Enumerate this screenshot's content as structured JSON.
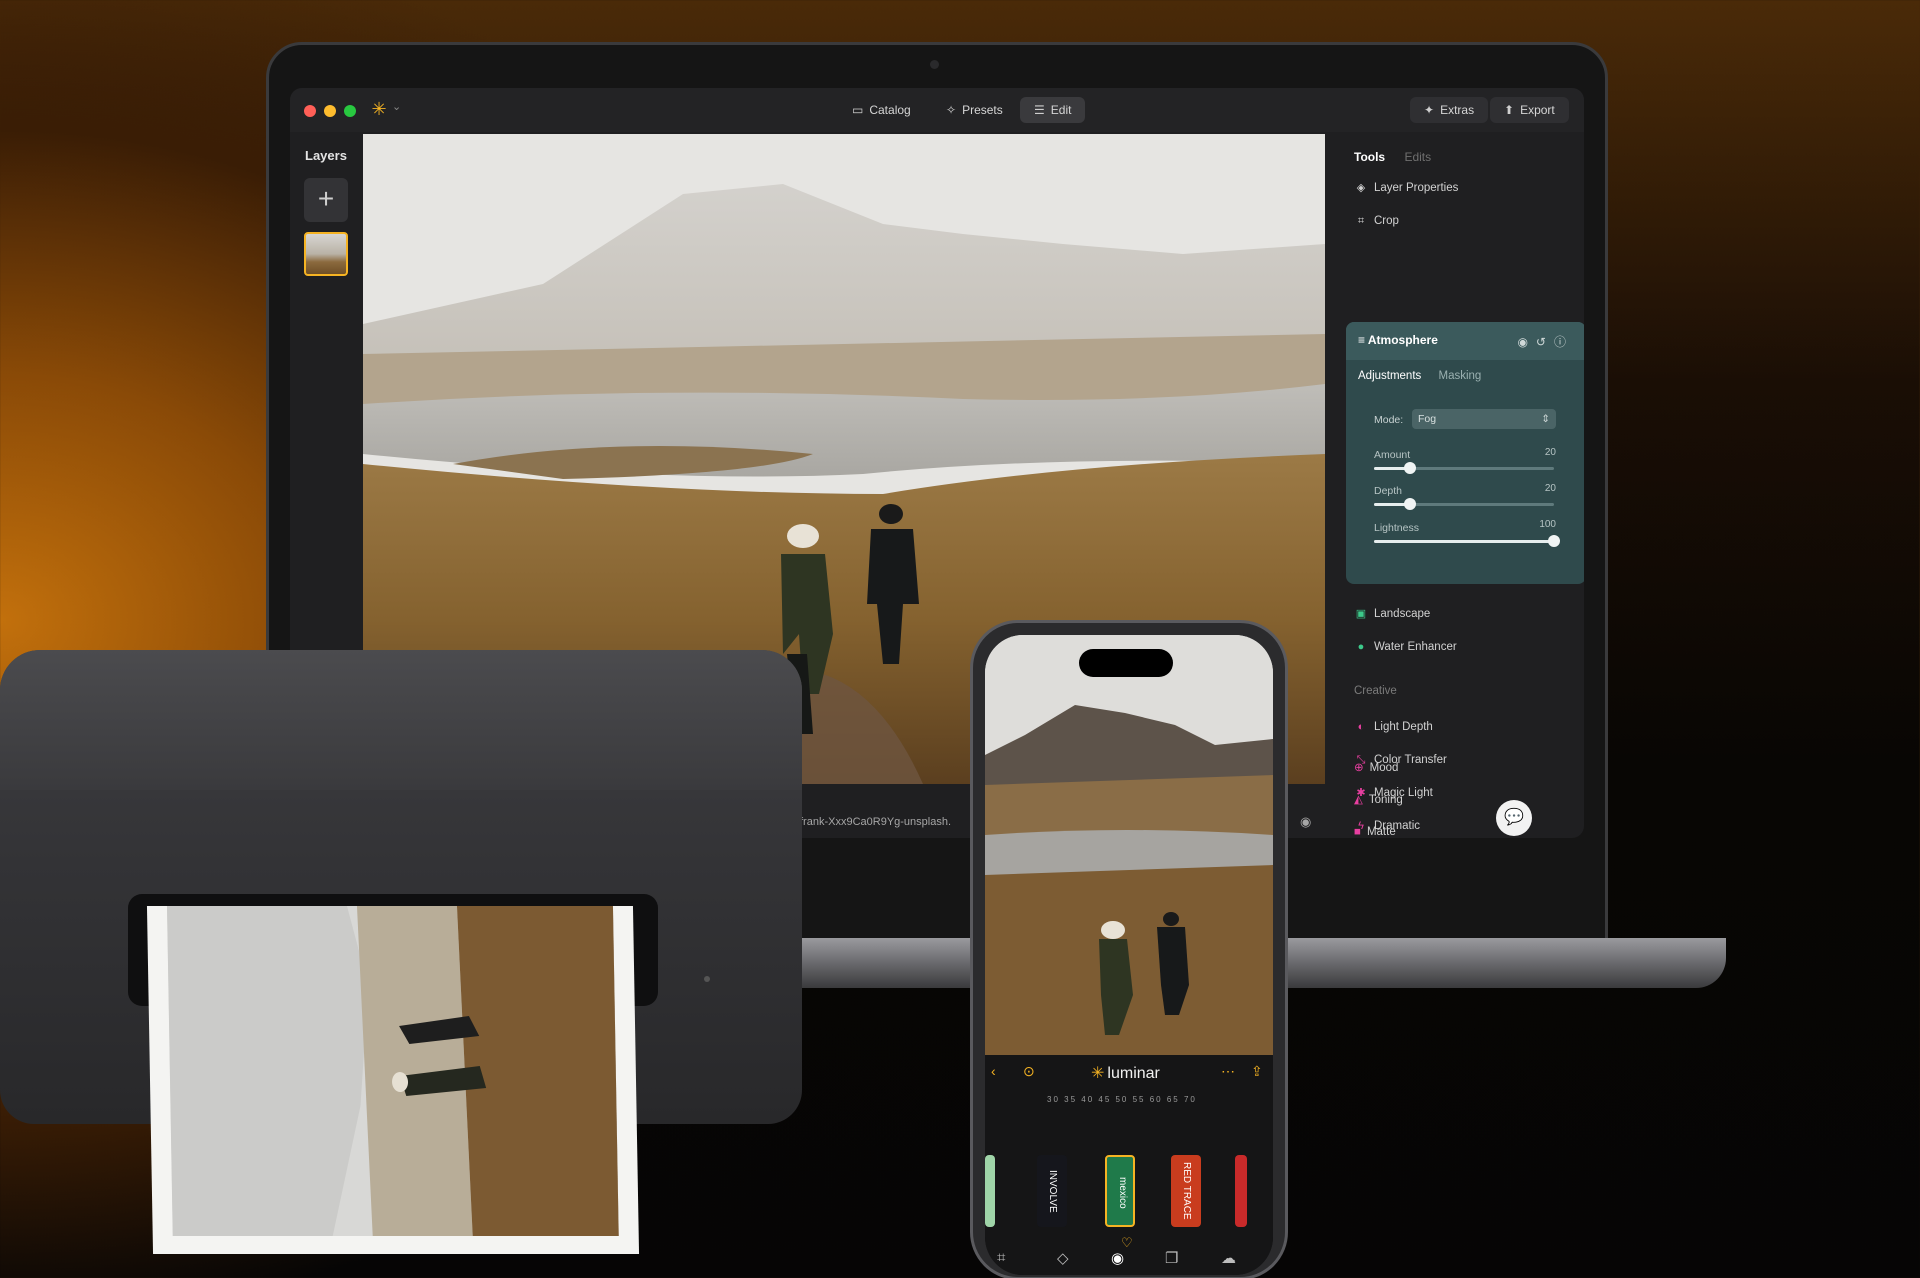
{
  "toolbar": {
    "catalog": "Catalog",
    "presets": "Presets",
    "edit": "Edit",
    "extras": "Extras",
    "export": "Export"
  },
  "layers": {
    "title": "Layers",
    "add": "+"
  },
  "canvas": {
    "filename": "frank-Xxx9Ca0R9Yg-unsplash."
  },
  "tools_panel": {
    "tab_tools": "Tools",
    "tab_edits": "Edits",
    "layer_properties": "Layer Properties",
    "crop": "Crop",
    "atmosphere": {
      "title": "Atmosphere",
      "tab_adjustments": "Adjustments",
      "tab_masking": "Masking",
      "mode_label": "Mode:",
      "mode_value": "Fog",
      "sliders": [
        {
          "label": "Amount",
          "value": "20",
          "fraction": 0.2
        },
        {
          "label": "Depth",
          "value": "20",
          "fraction": 0.2
        },
        {
          "label": "Lightness",
          "value": "100",
          "fraction": 1.0
        }
      ]
    },
    "landscape": "Landscape",
    "water_enhancer": "Water Enhancer",
    "creative_label": "Creative",
    "creative_items": [
      "Light Depth",
      "Color Transfer",
      "Magic Light",
      "Dramatic",
      "Mood",
      "Toning",
      "Matte"
    ]
  },
  "phone": {
    "brand": "luminar",
    "scale": "30 35 40 45 50 55 60 65 70",
    "films": [
      "INVOLVE",
      "mexico",
      "RED TRACE"
    ]
  },
  "colors": {
    "accent": "#f5b323",
    "panel_teal": "#2f4a4c",
    "close": "#ff5f57",
    "minimize": "#febc2e",
    "zoom": "#28c840"
  }
}
